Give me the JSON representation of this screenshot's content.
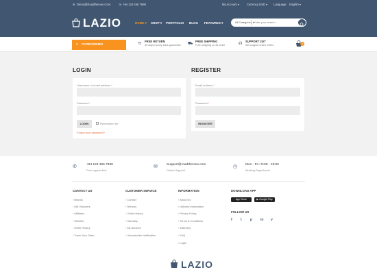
{
  "topbar": {
    "email": "Demo@Roadthemes.Com",
    "phone": "+84 123 456 7899",
    "my_account": "My Account",
    "currency_label": "Currency",
    "currency_value": "USD",
    "language_label": "Language",
    "language_value": "English"
  },
  "header": {
    "logo_text": "LAZIO",
    "nav": [
      "HOME",
      "SHOP",
      "PORTFOLIO",
      "BLOG",
      "FEATURES"
    ],
    "search": {
      "category": "All Categories",
      "placeholder": "Enter your search..."
    }
  },
  "infobar": {
    "categories_label": "CATEGORIES",
    "features": [
      {
        "title": "FREE RETURN",
        "sub": "30 days money back guarantee"
      },
      {
        "title": "FREE SHIPPING",
        "sub": "Free shipping on all order"
      },
      {
        "title": "SUPPORT 24/7",
        "sub": "We support online 24hrs"
      }
    ],
    "cart_count": "0"
  },
  "login": {
    "title": "LOGIN",
    "username_label": "Username or email address",
    "password_label": "Password",
    "button": "LOGIN",
    "remember": "Remember me",
    "forgot": "Forgot your password?"
  },
  "register": {
    "title": "REGISTER",
    "email_label": "Email address",
    "password_label": "Password",
    "button": "REGISTER"
  },
  "contact": [
    {
      "value": "+84 123 456 7899",
      "sub": "Free support line!"
    },
    {
      "value": "Support@roadthemes.com",
      "sub": "Orders Support!"
    },
    {
      "value": "Mon - Fri / 8:00 - 18:00",
      "sub": "Working Days/Hours!"
    }
  ],
  "footer": {
    "contact_us": {
      "title": "CONTACT US",
      "links": [
        "Brands",
        "Gift Vouchers",
        "Affiliates",
        "Wishlist",
        "Order History",
        "Track Your Order"
      ]
    },
    "customer_service": {
      "title": "CUSTOMER SERVICE",
      "links": [
        "Contact",
        "Returns",
        "Order History",
        "Site Map",
        "My Account",
        "Unsubscribe Notification"
      ]
    },
    "information": {
      "title": "INFORMATION",
      "links": [
        "About Us",
        "Delivery Information",
        "Privacy Policy",
        "Terms & Conditions",
        "Warranty",
        "FAQ",
        "Login"
      ]
    },
    "download_app": {
      "title": "DOWNLOAD APP",
      "app_store": "App Store",
      "google_play": "Google Play"
    },
    "follow_us": {
      "title": "FOLLOW US",
      "icons": [
        "f",
        "t",
        "p",
        "in",
        "v"
      ]
    },
    "logo_text": "LAZIO"
  },
  "colors": {
    "header": "#415671",
    "accent": "#f7931e",
    "link_orange": "#e0653a"
  }
}
